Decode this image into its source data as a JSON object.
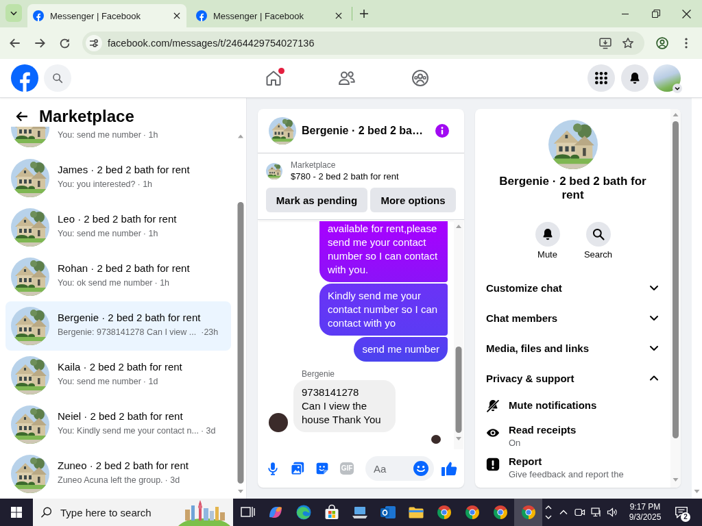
{
  "browser": {
    "tabs": [
      {
        "title": "Messenger | Facebook",
        "selected": true
      },
      {
        "title": "Messenger | Facebook",
        "selected": false
      }
    ],
    "address": "facebook.com/messages/t/2464429754027136"
  },
  "top_nav": {
    "items": [
      {
        "kind": "home",
        "notification": true
      },
      {
        "kind": "friends",
        "notification": false
      },
      {
        "kind": "groups",
        "notification": false
      }
    ]
  },
  "sidebar": {
    "title": "Marketplace",
    "conversations": [
      {
        "preview": "You: send me number",
        "time": "· 1h",
        "selected": false
      },
      {
        "name": "James · 2 bed 2 bath for rent",
        "preview": "You: you interested?",
        "time": "· 1h",
        "selected": false
      },
      {
        "name": "Leo · 2 bed 2 bath for rent",
        "preview": "You: send me number",
        "time": "· 1h",
        "selected": false
      },
      {
        "name": "Rohan · 2 bed 2 bath for rent",
        "preview": "You: ok send me number",
        "time": "· 1h",
        "selected": false
      },
      {
        "name": "Bergenie · 2 bed 2 bath for rent",
        "preview": "Bergenie: 9738141278 Can I view ...",
        "time": "·23h",
        "selected": true
      },
      {
        "name": "Kaila · 2 bed 2 bath for rent",
        "preview": "You: send me number",
        "time": "· 1d",
        "selected": false
      },
      {
        "name": "Neiel · 2 bed 2 bath for rent",
        "preview": "You: Kindly send me your contact n...",
        "time": "· 3d",
        "selected": false
      },
      {
        "name": "Zuneo · 2 bed 2 bath for rent",
        "preview": "Zuneo Acuna left the group.",
        "time": "· 3d",
        "selected": false
      }
    ]
  },
  "chat": {
    "title": "Bergenie · 2 bed 2 ba…",
    "listing": {
      "source": "Marketplace",
      "title": "$780 - 2 bed 2 bath for rent"
    },
    "actions": [
      "Mark as pending",
      "More options"
    ],
    "messages": [
      {
        "kind": "sent",
        "text": "available for rent,please send me your contact number so I can contact with you."
      },
      {
        "kind": "sent",
        "text": "Kindly send me your contact number so I can contact with yo"
      },
      {
        "kind": "sent",
        "text": "send me number"
      },
      {
        "kind": "received",
        "sender": "Bergenie",
        "text": "9738141278\nCan I view the house Thank You"
      }
    ],
    "composer": {
      "gif_label": "GIF",
      "placeholder": "Aa"
    }
  },
  "info_panel": {
    "name": "Bergenie · 2 bed 2 bath for rent",
    "actions": [
      {
        "kind": "mute",
        "label": "Mute"
      },
      {
        "kind": "search",
        "label": "Search"
      }
    ],
    "sections": [
      {
        "label": "Customize chat",
        "expanded": false
      },
      {
        "label": "Chat members",
        "expanded": false
      },
      {
        "label": "Media, files and links",
        "expanded": false
      },
      {
        "label": "Privacy & support",
        "expanded": true,
        "items": [
          {
            "kind": "mute",
            "title": "Mute notifications"
          },
          {
            "kind": "read_receipts",
            "title": "Read receipts",
            "subtitle": "On"
          },
          {
            "kind": "report",
            "title": "Report",
            "subtitle": "Give feedback and report the"
          }
        ]
      }
    ]
  },
  "taskbar": {
    "search": {
      "placeholder": "Type here to search"
    },
    "apps": [
      {
        "kind": "task_view",
        "selected": false
      },
      {
        "kind": "ribbon",
        "selected": false
      },
      {
        "kind": "swirl",
        "selected": false
      },
      {
        "kind": "store",
        "selected": false
      },
      {
        "kind": "laptop",
        "selected": false
      },
      {
        "kind": "mail",
        "selected": false
      },
      {
        "kind": "folder",
        "selected": false
      },
      {
        "kind": "browser",
        "selected": false
      },
      {
        "kind": "browser",
        "selected": false
      },
      {
        "kind": "browser",
        "selected": false
      },
      {
        "kind": "browser",
        "selected": true
      }
    ],
    "time": "9:17 PM",
    "date": "9/3/2025",
    "notification_count": "2"
  }
}
